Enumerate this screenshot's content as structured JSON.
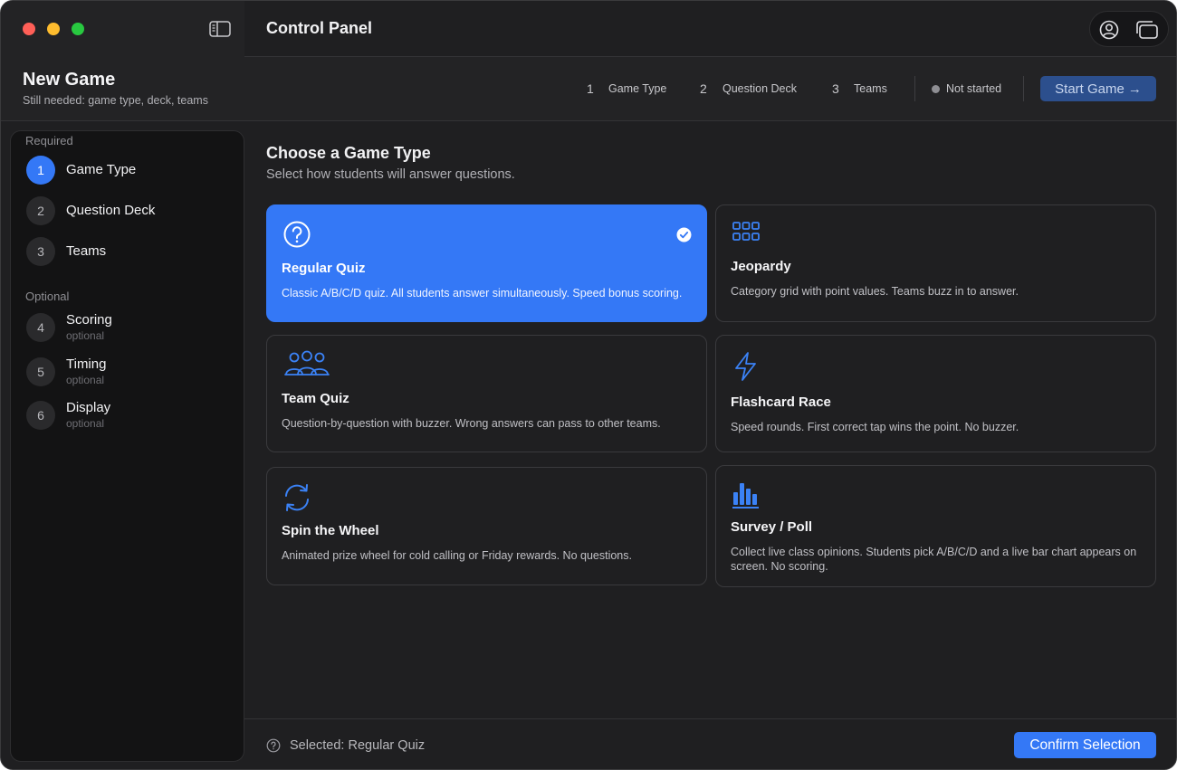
{
  "window": {
    "title": "Control Panel"
  },
  "header": {
    "game_title": "New Game",
    "game_subtitle": "Still needed: game type, deck, teams",
    "steps": [
      {
        "number": "1",
        "label": "Game Type"
      },
      {
        "number": "2",
        "label": "Question Deck"
      },
      {
        "number": "3",
        "label": "Teams"
      }
    ],
    "status": "Not started",
    "start_label": "Start Game",
    "start_arrow": "→"
  },
  "sidebar": {
    "required_label": "Required",
    "optional_label": "Optional",
    "required_items": [
      {
        "number": "1",
        "label": "Game Type",
        "active": true
      },
      {
        "number": "2",
        "label": "Question Deck"
      },
      {
        "number": "3",
        "label": "Teams"
      }
    ],
    "optional_items": [
      {
        "number": "4",
        "label": "Scoring",
        "note": "optional"
      },
      {
        "number": "5",
        "label": "Timing",
        "note": "optional"
      },
      {
        "number": "6",
        "label": "Display",
        "note": "optional"
      }
    ]
  },
  "main": {
    "title": "Choose a Game Type",
    "subtitle": "Select how students will answer questions.",
    "cards": [
      {
        "icon": "question-circle-icon",
        "title": "Regular Quiz",
        "description": "Classic A/B/C/D quiz. All students answer simultaneously. Speed bonus scoring.",
        "selected": true
      },
      {
        "icon": "grid-icon",
        "title": "Jeopardy",
        "description": "Category grid with point values. Teams buzz in to answer."
      },
      {
        "icon": "team-icon",
        "title": "Team Quiz",
        "description": "Question-by-question with buzzer. Wrong answers can pass to other teams."
      },
      {
        "icon": "lightning-icon",
        "title": "Flashcard Race",
        "description": "Speed rounds. First correct tap wins the point. No buzzer."
      },
      {
        "icon": "refresh-cycle-icon",
        "title": "Spin the Wheel",
        "description": "Animated prize wheel for cold calling or Friday rewards. No questions."
      },
      {
        "icon": "bar-chart-icon",
        "title": "Survey / Poll",
        "description": "Collect live class opinions. Students pick A/B/C/D and a live bar chart appears on screen. No scoring."
      }
    ]
  },
  "footer": {
    "selected_text": "Selected: Regular Quiz",
    "confirm_label": "Confirm Selection"
  },
  "colors": {
    "accent": "#3478f6",
    "background": "#1f1f21",
    "sidebar": "#131314"
  }
}
